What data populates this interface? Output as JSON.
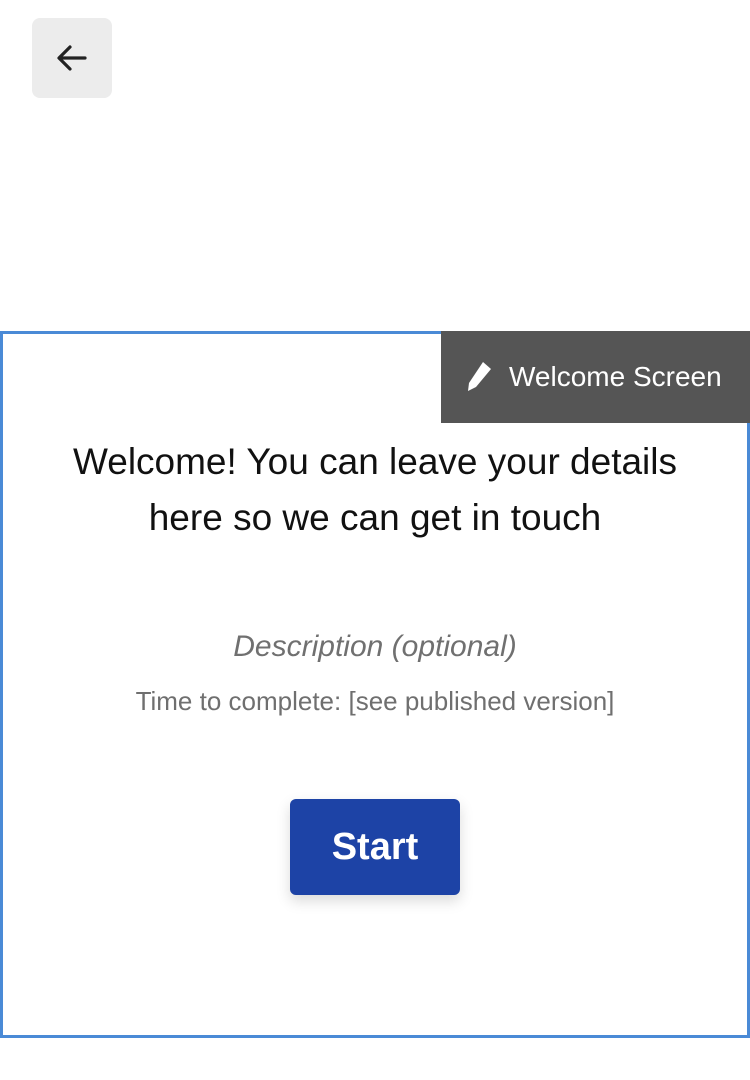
{
  "toolbar": {
    "back_icon": "arrow-left-icon"
  },
  "block": {
    "tag_icon": "pencil-icon",
    "tag_label": "Welcome Screen",
    "title": "Welcome! You can leave your details here so we can get in touch",
    "description_placeholder": "Description (optional)",
    "time_to_complete": "Time to complete: [see published version]",
    "start_label": "Start"
  },
  "colors": {
    "frame_border": "#4a8ad6",
    "tag_background": "#555555",
    "start_button": "#1d43a6"
  }
}
